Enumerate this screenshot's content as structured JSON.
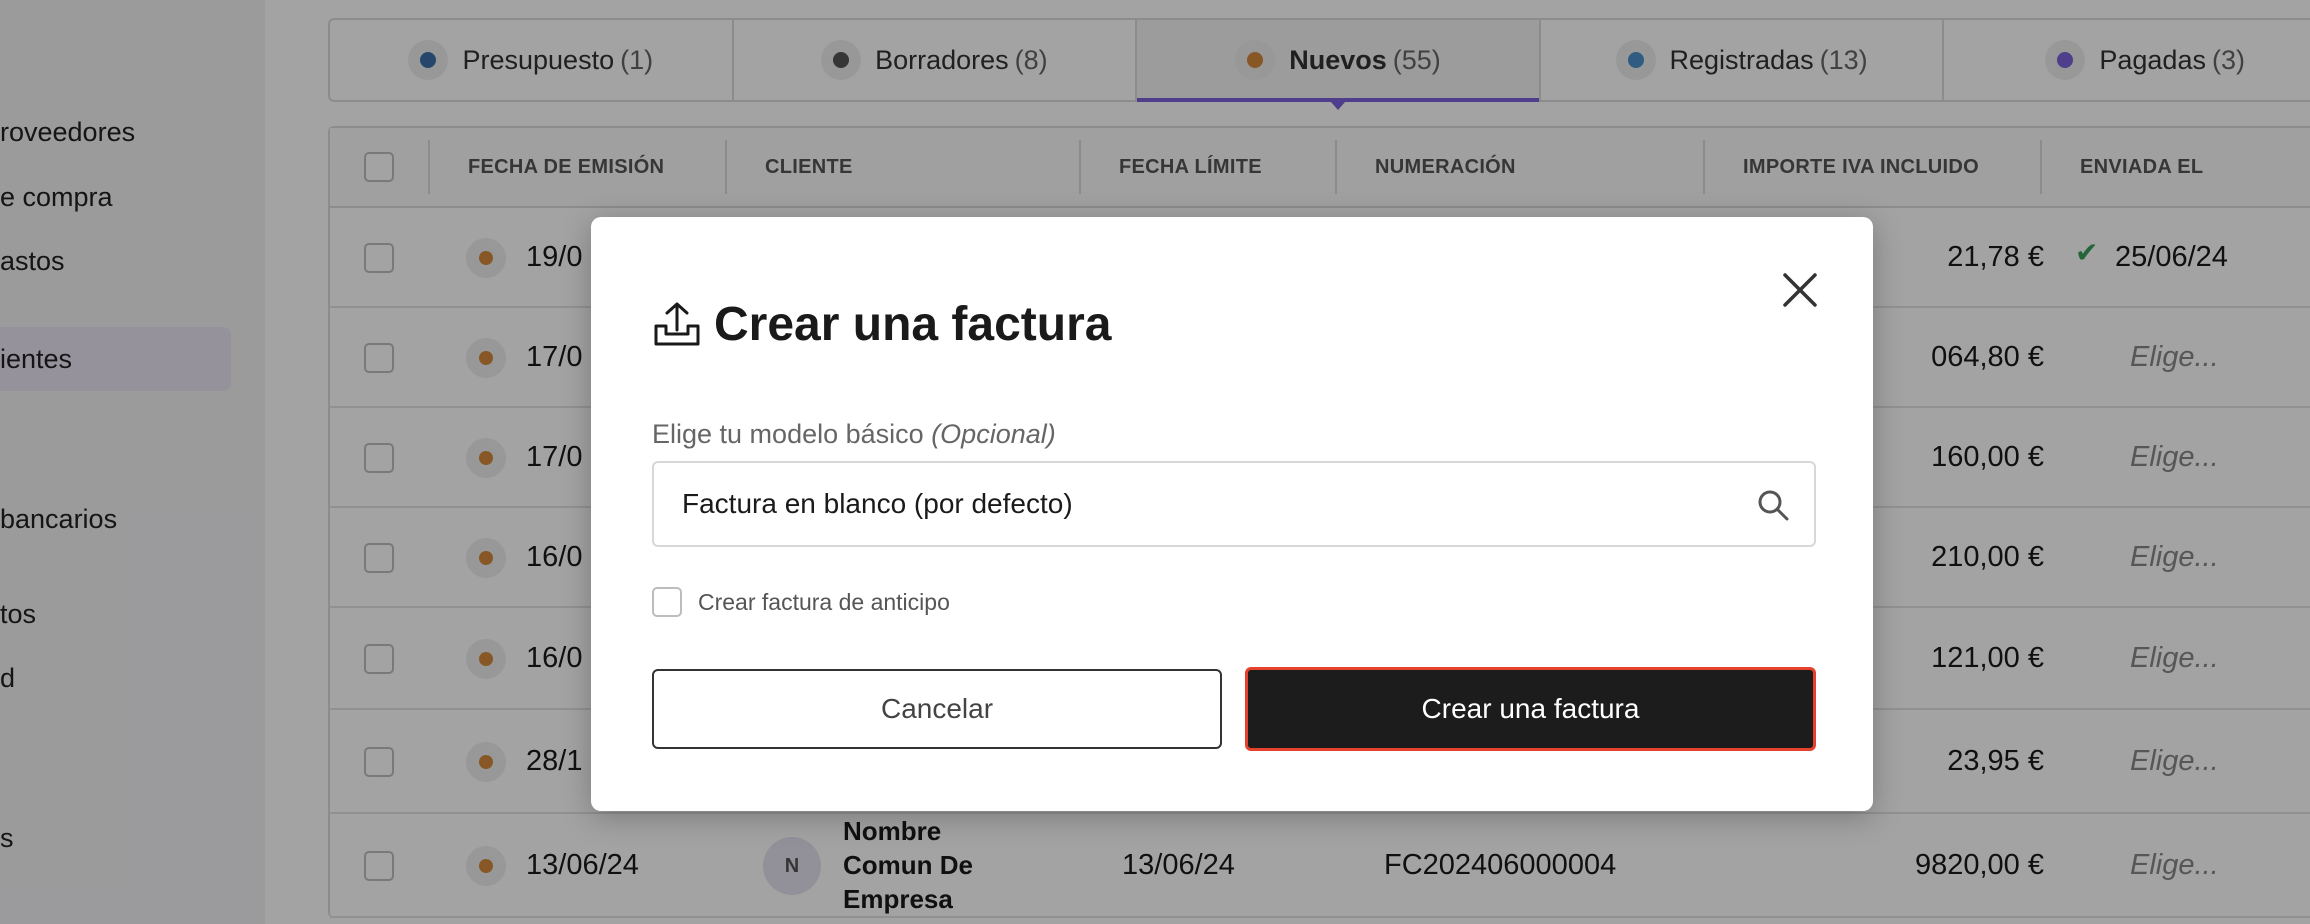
{
  "sidebar": {
    "items": [
      {
        "label": "roveedores"
      },
      {
        "label": "e compra"
      },
      {
        "label": "astos"
      },
      {
        "label": "ientes"
      },
      {
        "label": "bancarios"
      },
      {
        "label": "tos"
      },
      {
        "label": "d"
      },
      {
        "label": "s"
      }
    ]
  },
  "tabs": [
    {
      "label": "Presupuesto",
      "count": "(1)",
      "color": "#3d6ea8"
    },
    {
      "label": "Borradores",
      "count": "(8)",
      "color": "#555555"
    },
    {
      "label": "Nuevos",
      "count": "(55)",
      "color": "#d48a3b"
    },
    {
      "label": "Registradas",
      "count": "(13)",
      "color": "#4a90c8"
    },
    {
      "label": "Pagadas",
      "count": "(3)",
      "color": "#7b61d9"
    }
  ],
  "table": {
    "columns": [
      "FECHA DE EMISIÓN",
      "CLIENTE",
      "FECHA LÍMITE",
      "NUMERACIÓN",
      "IMPORTE IVA INCLUIDO",
      "ENVIADA EL"
    ],
    "rows": [
      {
        "fecha": "19/0",
        "importe": "21,78 €",
        "enviada": "25/06/24"
      },
      {
        "fecha": "17/0",
        "importe": "064,80 €",
        "enviada": "Elige..."
      },
      {
        "fecha": "17/0",
        "importe": "160,00 €",
        "enviada": "Elige..."
      },
      {
        "fecha": "16/0",
        "importe": "210,00 €",
        "enviada": "Elige..."
      },
      {
        "fecha": "16/0",
        "importe": "121,00 €",
        "enviada": "Elige..."
      },
      {
        "fecha": "28/1",
        "importe": "23,95 €",
        "enviada": "Elige..."
      },
      {
        "fecha": "13/06/24",
        "avatar": "N",
        "cliente_l1": "Nombre",
        "cliente_l2": "Comun De",
        "cliente_l3": "Empresa",
        "limite": "13/06/24",
        "numeracion": "FC202406000004",
        "importe": "9820,00 €",
        "enviada": "Elige..."
      }
    ]
  },
  "modal": {
    "title": "Crear una factura",
    "field_label": "Elige tu modelo básico",
    "field_label_optional": "(Opcional)",
    "select_value": "Factura en blanco (por defecto)",
    "checkbox_label": "Crear factura de anticipo",
    "cancel_label": "Cancelar",
    "create_label": "Crear una factura",
    "accent_color": "#e4422c"
  }
}
